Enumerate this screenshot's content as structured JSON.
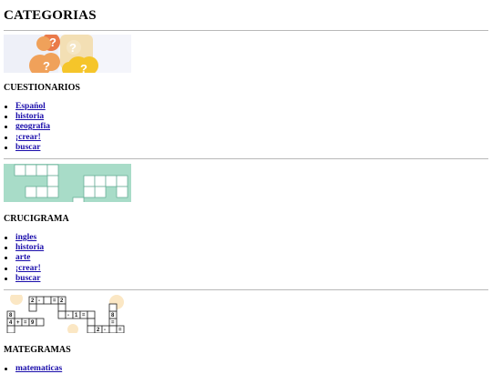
{
  "page": {
    "title": "CATEGORIAS"
  },
  "sections": [
    {
      "heading": "CUESTIONARIOS",
      "banner_icon": "question-bubbles-image",
      "links": [
        "Español",
        "historia",
        "geografia",
        "¡crear!",
        "buscar"
      ]
    },
    {
      "heading": "CRUCIGRAMA",
      "banner_icon": "crossword-grid-image",
      "links": [
        "ingles",
        "historia",
        "arte",
        "¡crear!",
        "buscar"
      ]
    },
    {
      "heading": "MATEGRAMAS",
      "banner_icon": "math-puzzle-grid-image",
      "links": [
        "matematicas"
      ]
    }
  ],
  "colors": {
    "link": "#1a0dab",
    "rule": "#b9b9b9",
    "crossword_bg": "#a8dcc8",
    "bubble_orange": "#f0a15a",
    "bubble_red": "#ea7a4a",
    "bubble_yellow": "#f5c52a",
    "bubble_cream": "#f3dfb4"
  }
}
